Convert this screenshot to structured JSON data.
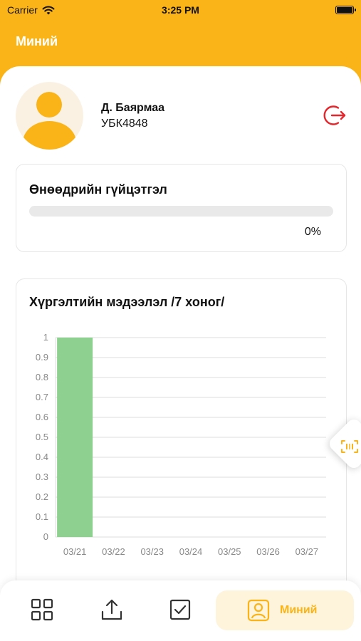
{
  "status_bar": {
    "carrier": "Carrier",
    "time": "3:25 PM"
  },
  "header": {
    "title": "Миний"
  },
  "profile": {
    "name": "Д. Баярмаа",
    "code": "УБК4848"
  },
  "daily_progress": {
    "title": "Өнөөдрийн гүйцэтгэл",
    "value_text": "0%",
    "value": 0
  },
  "delivery_chart": {
    "title": "Хүргэлтийн мэдээлэл /7 хоног/"
  },
  "chart_data": {
    "type": "bar",
    "categories": [
      "03/21",
      "03/22",
      "03/23",
      "03/24",
      "03/25",
      "03/26",
      "03/27"
    ],
    "values": [
      1,
      0,
      0,
      0,
      0,
      0,
      0
    ],
    "ylim": [
      0,
      1
    ],
    "yticks": [
      "0",
      "0.1",
      "0.2",
      "0.3",
      "0.4",
      "0.5",
      "0.6",
      "0.7",
      "0.8",
      "0.9",
      "1"
    ],
    "grid": true,
    "bar_color": "#8ED08F"
  },
  "bottom_nav": {
    "active_label": "Миний"
  },
  "colors": {
    "accent": "#FBB417",
    "logout": "#E5262C",
    "bar": "#8ED08F"
  }
}
